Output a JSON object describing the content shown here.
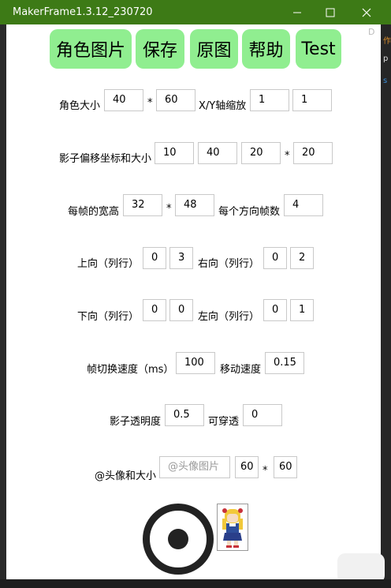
{
  "window": {
    "title": "MakerFrame1.3.12_230720"
  },
  "toolbar": {
    "buttons": [
      "角色图片",
      "保存",
      "原图",
      "帮助",
      "Test"
    ]
  },
  "side_label": "D",
  "right_strip": [
    "作",
    "p",
    "s"
  ],
  "role_size": {
    "label": "角色大小",
    "w": "40",
    "h": "60",
    "scale_label": "X/Y轴缩放",
    "sx": "1",
    "sy": "1"
  },
  "shadow": {
    "label": "影子偏移坐标和大小",
    "x": "10",
    "y": "40",
    "w": "20",
    "h": "20"
  },
  "frame": {
    "label": "每帧的宽高",
    "w": "32",
    "h": "48",
    "count_label": "每个方向帧数",
    "count": "4"
  },
  "up": {
    "label": "上向（列行）",
    "col": "0",
    "row": "3"
  },
  "right": {
    "label": "右向（列行）",
    "col": "0",
    "row": "2"
  },
  "down": {
    "label": "下向（列行）",
    "col": "0",
    "row": "0"
  },
  "left": {
    "label": "左向（列行）",
    "col": "0",
    "row": "1"
  },
  "speed": {
    "label": "帧切换速度（ms）",
    "value": "100",
    "move_label": "移动速度",
    "move": "0.15"
  },
  "alpha": {
    "label": "影子透明度",
    "value": "0.5",
    "pass_label": "可穿透",
    "pass": "0"
  },
  "avatar": {
    "label": "@头像和大小",
    "placeholder": "@头像图片",
    "w": "60",
    "h": "60"
  },
  "times": "*",
  "colors": {
    "titlebar": "#3d7a16",
    "button": "#90ee90"
  }
}
